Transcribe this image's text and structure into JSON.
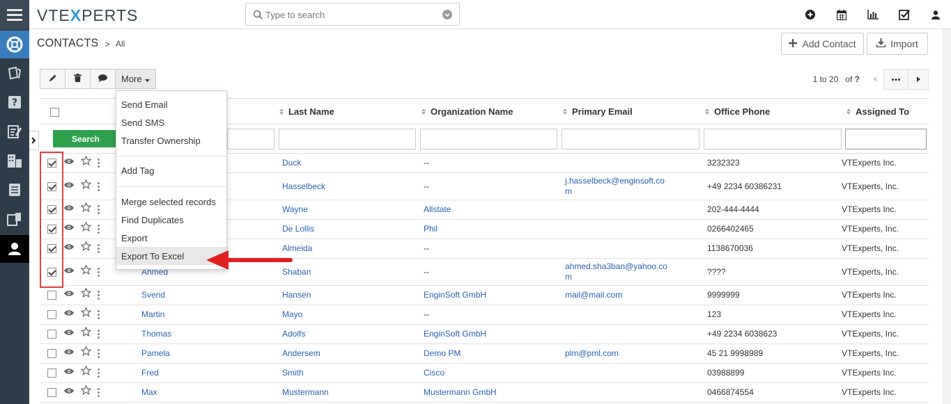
{
  "app": {
    "logo_prefix": "VTE",
    "logo_x": "X",
    "logo_suffix": "PERTS"
  },
  "search": {
    "placeholder": "Type to search"
  },
  "breadcrumb": {
    "module": "CONTACTS",
    "separator": ">",
    "filter": "All"
  },
  "actions": {
    "add_contact": "Add Contact",
    "import": "Import"
  },
  "toolbar": {
    "more": "More"
  },
  "pager": {
    "range": "1 to 20",
    "of": "of",
    "total": "?"
  },
  "columns": {
    "last_name": "Last Name",
    "organization": "Organization Name",
    "email": "Primary Email",
    "phone": "Office Phone",
    "assigned": "Assigned To"
  },
  "filter": {
    "search_label": "Search"
  },
  "menu": {
    "items": [
      "Send Email",
      "Send SMS",
      "Transfer Ownership",
      "Add Tag",
      "Merge selected records",
      "Find Duplicates",
      "Export",
      "Export To Excel"
    ],
    "highlighted": "Export To Excel"
  },
  "rows": [
    {
      "selected": true,
      "first": "",
      "last": "Duck",
      "org": "--",
      "email": "",
      "phone": "3232323",
      "assigned": "VTExperts Inc."
    },
    {
      "selected": true,
      "first": "",
      "last": "Hasselbeck",
      "org": "--",
      "email": "j.hasselbeck@enginsoft.co",
      "email2": "m",
      "phone": "+49 2234 60386231",
      "assigned": "VTExperts, Inc."
    },
    {
      "selected": true,
      "first": "",
      "last": "Wayne",
      "org": "Allstate",
      "email": "",
      "phone": "202-444-4444",
      "assigned": "VTExperts Inc."
    },
    {
      "selected": true,
      "first": "",
      "last": "De Lollis",
      "org": "Phil",
      "email": "",
      "phone": "0266402465",
      "assigned": "VTExperts, Inc."
    },
    {
      "selected": true,
      "first": "",
      "last": "Almeida",
      "org": "--",
      "email": "",
      "phone": "1138670036",
      "assigned": "VTExperts, Inc."
    },
    {
      "selected": true,
      "first": "Ahmed",
      "last": "Shaban",
      "org": "--",
      "email": "ahmed.sha3ban@yahoo.co",
      "email2": "m",
      "phone": "????",
      "assigned": "VTExperts, Inc."
    },
    {
      "selected": false,
      "first": "Svend",
      "last": "Hansen",
      "org": "EnginSoft GmbH",
      "email": "mail@mail.com",
      "phone": "9999999",
      "assigned": "VTExperts Inc."
    },
    {
      "selected": false,
      "first": "Martin",
      "last": "Mayo",
      "org": "--",
      "email": "",
      "phone": "123",
      "assigned": "VTExperts Inc."
    },
    {
      "selected": false,
      "first": "Thomas",
      "last": "Adolfs",
      "org": "EnginSoft GmbH",
      "email": "",
      "phone": "+49 2234 6038623",
      "assigned": "VTExperts, Inc."
    },
    {
      "selected": false,
      "first": "Pamela",
      "last": "Andersem",
      "org": "Demo PM",
      "email": "plm@pml.com",
      "phone": "45 21 9998989",
      "assigned": "VTExperts, Inc."
    },
    {
      "selected": false,
      "first": "Fred",
      "last": "Smith",
      "org": "Cisco",
      "email": "",
      "phone": "03988899",
      "assigned": "VTExperts Inc."
    },
    {
      "selected": false,
      "first": "Max",
      "last": "Mustermann",
      "org": "Mustermann GmbH",
      "email": "",
      "phone": "0466874554",
      "assigned": "VTExperts Inc."
    }
  ],
  "colors": {
    "sidebar": "#2f3d4a",
    "link": "#2a62b0",
    "search_button": "#2fa04b",
    "annotation": "#e04040"
  },
  "icons": [
    "menu-icon",
    "help-desk-icon",
    "marketing-icon",
    "support-icon",
    "projects-icon",
    "organizations-icon",
    "inventory-icon",
    "tools-icon",
    "contacts-icon",
    "plus-circle-icon",
    "calendar-icon",
    "reports-icon",
    "tasks-icon",
    "user-icon",
    "search-icon",
    "pencil-icon",
    "trash-icon",
    "comment-icon",
    "eye-icon",
    "star-icon"
  ]
}
